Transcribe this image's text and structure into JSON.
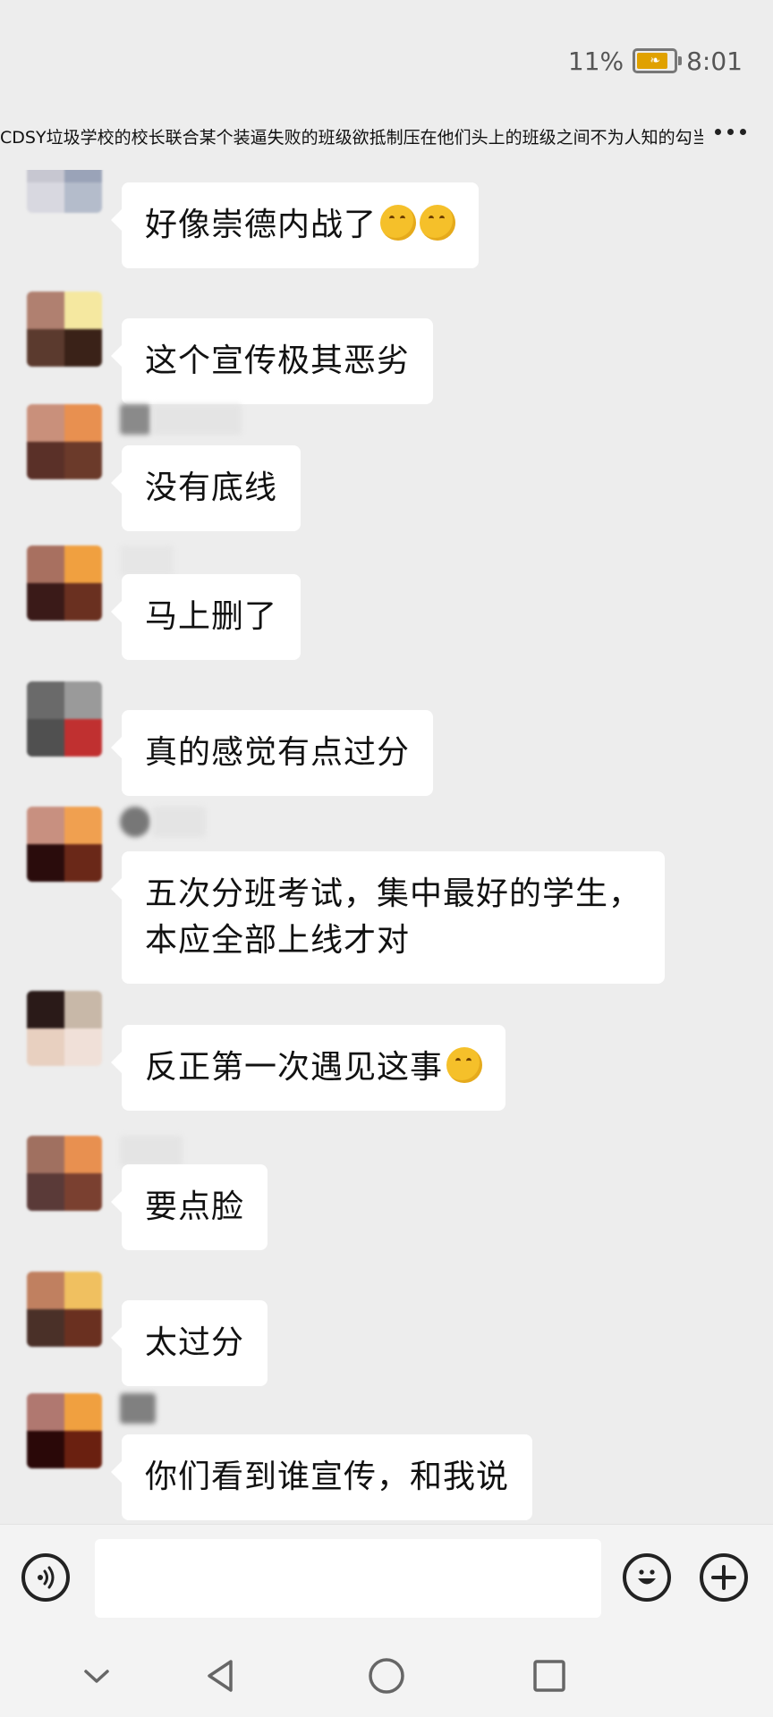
{
  "status": {
    "battery_text": "11%",
    "battery_level": 0.11,
    "time": "8:01"
  },
  "chat": {
    "title": "CDSY垃圾学校的校长联合某个装逼失败的班级欲抵制压在他们头上的班级之间不为人知的勾当"
  },
  "messages": [
    {
      "text": "好像崇德内战了",
      "emoji_count": 2
    },
    {
      "text": "这个宣传极其恶劣",
      "emoji_count": 0
    },
    {
      "text": "没有底线",
      "emoji_count": 0
    },
    {
      "text": "马上删了",
      "emoji_count": 0
    },
    {
      "text": "真的感觉有点过分",
      "emoji_count": 0
    },
    {
      "line1": "五次分班考试，集中最好的学生，",
      "line2": "本应全部上线才对",
      "emoji_count": 0
    },
    {
      "text": "反正第一次遇见这事",
      "emoji_count": 1
    },
    {
      "text": "要点脸",
      "emoji_count": 0
    },
    {
      "text": "太过分",
      "emoji_count": 0
    },
    {
      "text": "你们看到谁宣传，和我说",
      "emoji_count": 0
    }
  ],
  "icons": {
    "voice": "voice-icon",
    "emoji": "emoji-smile-icon",
    "add": "plus-icon",
    "back": "nav-back-icon",
    "home": "nav-home-icon",
    "recents": "nav-recents-icon",
    "down": "nav-down-icon"
  },
  "colors": {
    "background": "#ededed",
    "bubble": "#ffffff",
    "battery": "#e0a100"
  }
}
